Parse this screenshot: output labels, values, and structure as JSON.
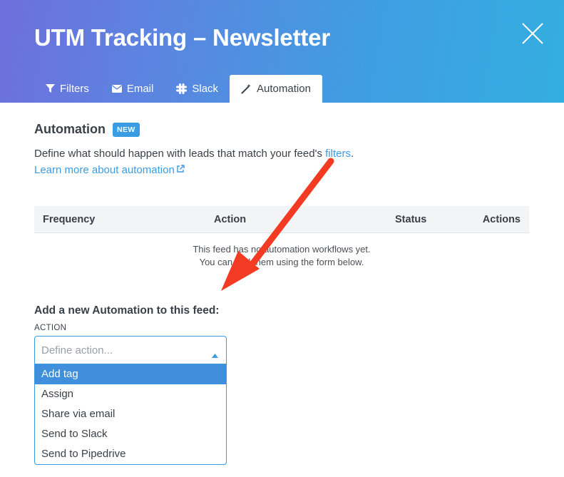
{
  "window": {
    "title": "UTM Tracking – Newsletter",
    "close_icon": "close-icon"
  },
  "tabs": [
    {
      "label": "Filters",
      "icon": "filter-icon",
      "active": false
    },
    {
      "label": "Email",
      "icon": "envelope-icon",
      "active": false
    },
    {
      "label": "Slack",
      "icon": "slack-icon",
      "active": false
    },
    {
      "label": "Automation",
      "icon": "magic-wand-icon",
      "active": true
    }
  ],
  "automation": {
    "heading": "Automation",
    "badge": "NEW",
    "description_prefix": "Define what should happen with leads that match your feed's ",
    "description_link": "filters",
    "description_suffix": ".",
    "learn_more": "Learn more about automation"
  },
  "table": {
    "columns": [
      "Frequency",
      "Action",
      "Status",
      "Actions"
    ],
    "empty_line1": "This feed has no automation workflows yet.",
    "empty_line2": "You can add them using the form below."
  },
  "form": {
    "title": "Add a new Automation to this feed:",
    "action_label": "ACTION",
    "select_placeholder": "Define action...",
    "options": [
      "Add tag",
      "Assign",
      "Share via email",
      "Send to Slack",
      "Send to Pipedrive"
    ],
    "highlighted_option": "Add tag"
  },
  "colors": {
    "accent": "#3a9ce2",
    "annotation_arrow": "#f33a22"
  }
}
